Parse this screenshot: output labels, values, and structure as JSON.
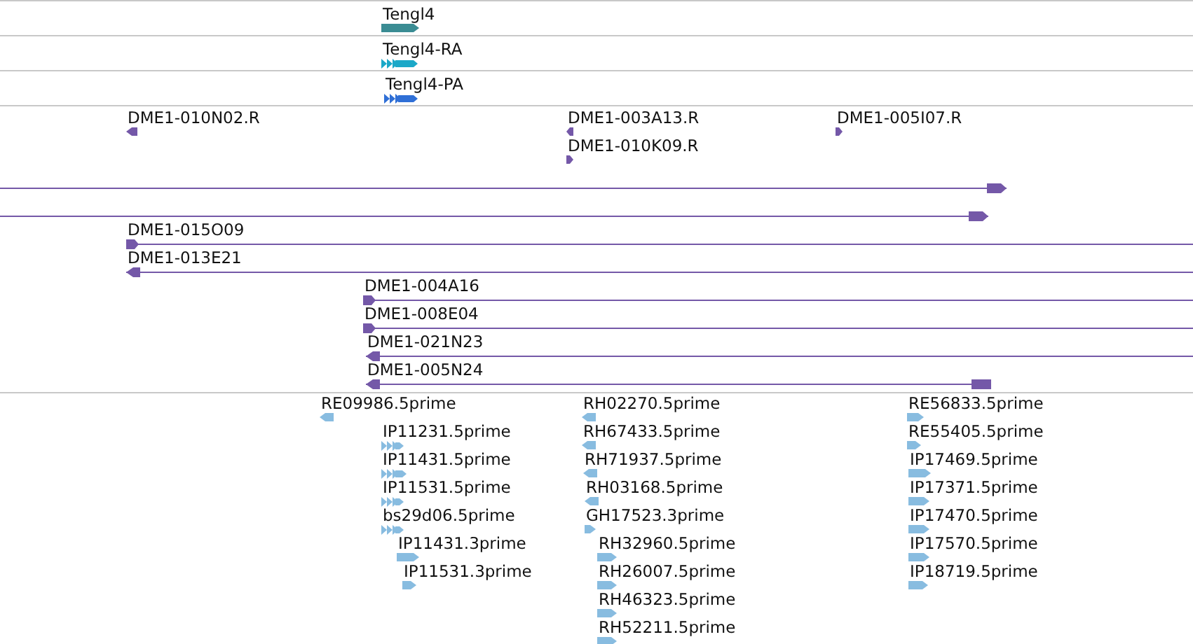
{
  "tracks": [
    {
      "color": "#3a8c93",
      "features": [
        {
          "label": "Tengl4",
          "reverse": false,
          "kind": "block"
        }
      ]
    },
    {
      "color": "#1ba8c8",
      "features": [
        {
          "label": "Tengl4-RA",
          "reverse": false,
          "kind": "chevrons"
        }
      ]
    },
    {
      "color": "#2f6fd6",
      "features": [
        {
          "label": "Tengl4-PA",
          "reverse": false,
          "kind": "chevrons"
        }
      ]
    },
    {
      "color": "#7458a8",
      "features": [
        {
          "label": "DME1-010N02.R",
          "reverse": true,
          "kind": "block"
        },
        {
          "label": "DME1-003A13.R",
          "reverse": true,
          "kind": "block"
        },
        {
          "label": "DME1-005I07.R",
          "reverse": false,
          "kind": "block"
        },
        {
          "label": "DME1-010K09.R",
          "reverse": false,
          "kind": "block"
        },
        {
          "reverse": false,
          "kind": "line"
        },
        {
          "reverse": false,
          "kind": "line"
        },
        {
          "label": "DME1-015O09",
          "reverse": false,
          "kind": "line"
        },
        {
          "label": "DME1-013E21",
          "reverse": true,
          "kind": "line"
        },
        {
          "label": "DME1-004A16",
          "reverse": false,
          "kind": "line"
        },
        {
          "label": "DME1-008E04",
          "reverse": false,
          "kind": "line"
        },
        {
          "label": "DME1-021N23",
          "reverse": true,
          "kind": "line"
        },
        {
          "label": "DME1-005N24",
          "reverse": true,
          "kind": "line"
        }
      ]
    },
    {
      "color": "#88bce0",
      "features": [
        {
          "label": "RE09986.5prime",
          "reverse": true,
          "kind": "block"
        },
        {
          "label": "IP11231.5prime",
          "reverse": false,
          "kind": "chevrons"
        },
        {
          "label": "IP11431.5prime",
          "reverse": false,
          "kind": "chevrons"
        },
        {
          "label": "IP11531.5prime",
          "reverse": false,
          "kind": "chevrons"
        },
        {
          "label": "bs29d06.5prime",
          "reverse": false,
          "kind": "chevrons"
        },
        {
          "label": "IP11431.3prime",
          "reverse": false,
          "kind": "block"
        },
        {
          "label": "IP11531.3prime",
          "reverse": false,
          "kind": "block"
        },
        {
          "label": "RH02270.5prime",
          "reverse": true,
          "kind": "block"
        },
        {
          "label": "RH67433.5prime",
          "reverse": true,
          "kind": "block"
        },
        {
          "label": "RH71937.5prime",
          "reverse": true,
          "kind": "block"
        },
        {
          "label": "RH03168.5prime",
          "reverse": true,
          "kind": "block"
        },
        {
          "label": "GH17523.3prime",
          "reverse": false,
          "kind": "block"
        },
        {
          "label": "RH32960.5prime",
          "reverse": false,
          "kind": "block"
        },
        {
          "label": "RH26007.5prime",
          "reverse": false,
          "kind": "block"
        },
        {
          "label": "RH46323.5prime",
          "reverse": false,
          "kind": "block"
        },
        {
          "label": "RH52211.5prime",
          "reverse": false,
          "kind": "block"
        },
        {
          "label": "RE56833.5prime",
          "reverse": false,
          "kind": "block"
        },
        {
          "label": "RE55405.5prime",
          "reverse": false,
          "kind": "block"
        },
        {
          "label": "IP17469.5prime",
          "reverse": false,
          "kind": "block"
        },
        {
          "label": "IP17371.5prime",
          "reverse": false,
          "kind": "block"
        },
        {
          "label": "IP17470.5prime",
          "reverse": false,
          "kind": "block"
        },
        {
          "label": "IP17570.5prime",
          "reverse": false,
          "kind": "block"
        },
        {
          "label": "IP18719.5prime",
          "reverse": false,
          "kind": "block"
        }
      ]
    }
  ]
}
